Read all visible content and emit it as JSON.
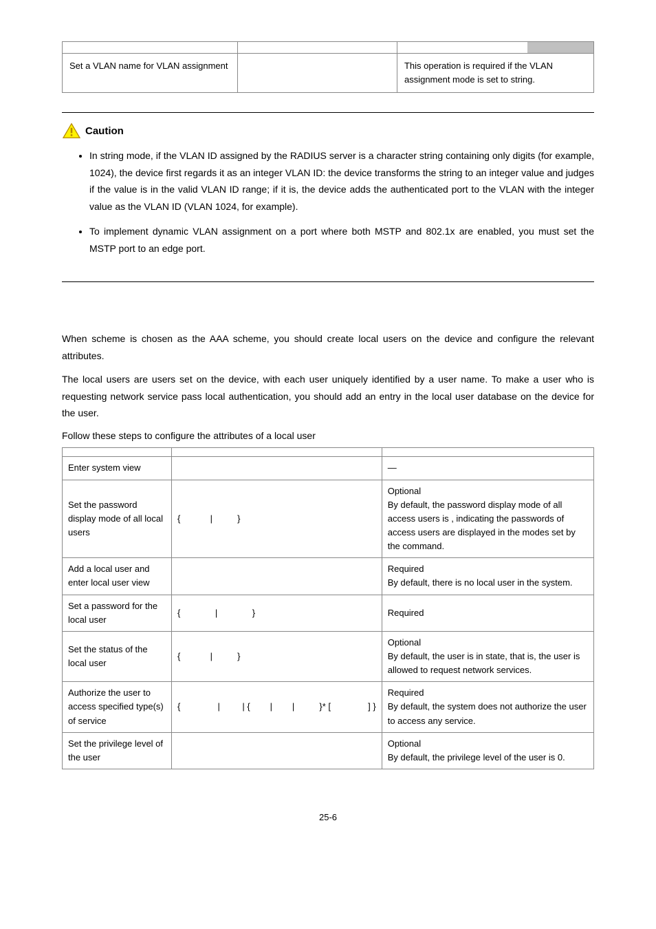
{
  "table1": {
    "row": {
      "c1": "Set a VLAN name for VLAN assignment",
      "c2": "",
      "c3": "This operation is required if the VLAN assignment mode is set to string."
    }
  },
  "caution": {
    "label": "Caution",
    "bullets": [
      "In string mode, if the VLAN ID assigned by the RADIUS server is a character string containing only digits (for example, 1024), the device first regards it as an integer VLAN ID: the device transforms the string to an integer value and judges if the value is in the valid VLAN ID range; if it is, the device adds the authenticated port to the VLAN with the integer value as the VLAN ID (VLAN 1024, for example).",
      "To implement dynamic VLAN assignment on a port where both MSTP and 802.1x are enabled, you must set the MSTP port to an edge port."
    ]
  },
  "para": {
    "p1": "When          scheme is chosen as the AAA scheme, you should create local users on the device and configure the relevant attributes.",
    "p2": "The local users are users set on the device, with each user uniquely identified by a user name. To make a user who is requesting network service pass local authentication, you should add an entry in the local user database on the device for the user.",
    "follow": "Follow these steps to configure the attributes of a local user"
  },
  "table2": {
    "rows": [
      {
        "c1": "Enter system view",
        "c2": "",
        "c3": "—"
      },
      {
        "c1": "Set the password display mode of all local users",
        "c2": "{            |          }",
        "c3": "Optional\nBy default, the password display mode of all access users is        , indicating the passwords of access users are displayed in the modes set by the              command."
      },
      {
        "c1": "Add a local user and enter local user view",
        "c2": "",
        "c3": "Required\nBy default, there is no local user in the system."
      },
      {
        "c1": "Set a password for the local user",
        "c2": "{              |              }",
        "c3": "Required"
      },
      {
        "c1": "Set the status of the local user",
        "c2": "{            |          }",
        "c3": "Optional\nBy default, the user is in           state, that is, the user is allowed to request network services."
      },
      {
        "c1": "Authorize the user to access specified type(s) of service",
        "c2": "{               |         | {        |        |          }* [               ] }",
        "c3": "Required\nBy default, the system does not authorize the user to access any service."
      },
      {
        "c1": "Set the privilege level of the user",
        "c2": "",
        "c3": "Optional\nBy default, the privilege level of the user is 0."
      }
    ]
  },
  "footer": "25-6"
}
